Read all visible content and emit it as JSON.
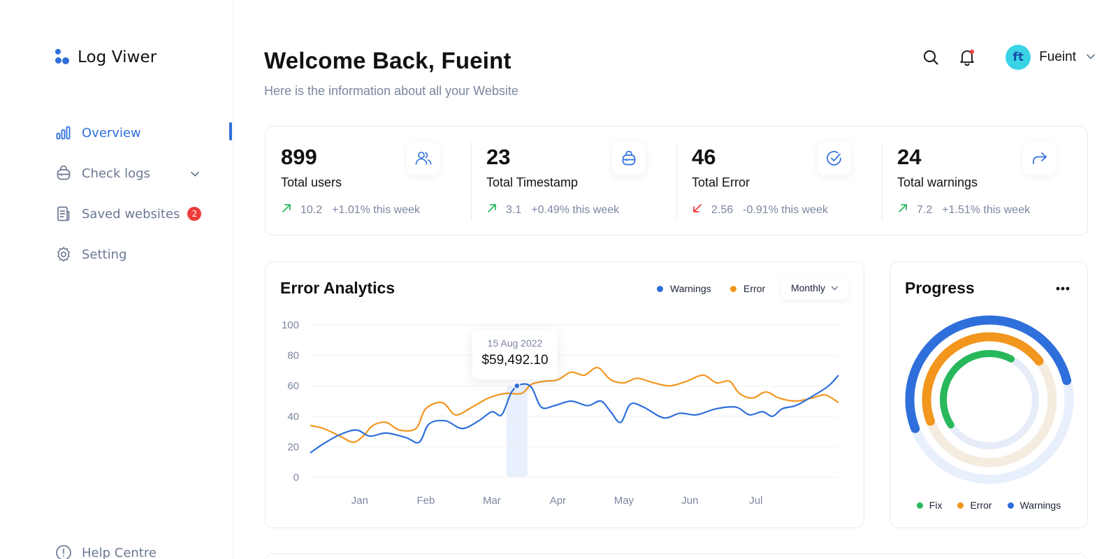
{
  "app": {
    "title": "Log Viwer"
  },
  "sidebar": {
    "items": [
      {
        "label": "Overview",
        "icon": "bar-chart-icon",
        "active": true
      },
      {
        "label": "Check logs",
        "icon": "bag-icon",
        "has_submenu": true
      },
      {
        "label": "Saved websites",
        "icon": "document-icon",
        "badge": "2"
      },
      {
        "label": "Setting",
        "icon": "gear-icon"
      }
    ],
    "help": {
      "label": "Help Centre",
      "icon": "info-icon"
    }
  },
  "header": {
    "title": "Welcome Back, Fueint",
    "subtitle": "Here is the information about all your Website",
    "user": {
      "name": "Fueint",
      "avatar_text": "ft"
    }
  },
  "stats": [
    {
      "value": "899",
      "label": "Total users",
      "trend_value": "10.2",
      "trend_text": "+1.01% this week",
      "direction": "up",
      "icon": "users-icon"
    },
    {
      "value": "23",
      "label": "Total Timestamp",
      "trend_value": "3.1",
      "trend_text": "+0.49% this week",
      "direction": "up",
      "icon": "bag-icon"
    },
    {
      "value": "46",
      "label": "Total Error",
      "trend_value": "2.56",
      "trend_text": "-0.91% this week",
      "direction": "down",
      "icon": "check-circle-icon"
    },
    {
      "value": "24",
      "label": "Total warnings",
      "trend_value": "7.2",
      "trend_text": "+1.51% this week",
      "direction": "up",
      "icon": "share-icon"
    }
  ],
  "analytics": {
    "title": "Error Analytics",
    "legend": [
      {
        "label": "Warnings",
        "color": "#2f6fdb"
      },
      {
        "label": "Error",
        "color": "#f2961e"
      }
    ],
    "period": "Monthly",
    "tooltip": {
      "date": "15 Aug 2022",
      "value": "$59,492.10"
    }
  },
  "chart_data": {
    "type": "line",
    "categories": [
      "Jan",
      "Feb",
      "Mar",
      "Apr",
      "May",
      "Jun",
      "Jul"
    ],
    "ylim": [
      0,
      100
    ],
    "yticks": [
      0,
      20,
      40,
      60,
      80,
      100
    ],
    "x_range": [
      0.25,
      7.5
    ],
    "grid": true,
    "series": [
      {
        "name": "Warnings",
        "color": "#2f6fdb",
        "points": [
          [
            0.25,
            16
          ],
          [
            0.45,
            22
          ],
          [
            0.7,
            28
          ],
          [
            0.95,
            31
          ],
          [
            1.15,
            27
          ],
          [
            1.4,
            29
          ],
          [
            1.7,
            26
          ],
          [
            1.9,
            23
          ],
          [
            2.05,
            35
          ],
          [
            2.3,
            37
          ],
          [
            2.55,
            32
          ],
          [
            2.8,
            37
          ],
          [
            3.0,
            43
          ],
          [
            3.15,
            41
          ],
          [
            3.3,
            56
          ],
          [
            3.45,
            61
          ],
          [
            3.6,
            59
          ],
          [
            3.75,
            46
          ],
          [
            3.95,
            47
          ],
          [
            4.2,
            50
          ],
          [
            4.45,
            47
          ],
          [
            4.65,
            50
          ],
          [
            4.8,
            43
          ],
          [
            4.95,
            36
          ],
          [
            5.1,
            48
          ],
          [
            5.3,
            46
          ],
          [
            5.6,
            39
          ],
          [
            5.85,
            42
          ],
          [
            6.1,
            41
          ],
          [
            6.4,
            45
          ],
          [
            6.7,
            46
          ],
          [
            6.9,
            41
          ],
          [
            7.1,
            43
          ],
          [
            7.25,
            40
          ],
          [
            7.4,
            45
          ],
          [
            7.6,
            47
          ],
          [
            7.85,
            53
          ],
          [
            8.1,
            60
          ],
          [
            8.25,
            67
          ]
        ]
      },
      {
        "name": "Error",
        "color": "#f2961e",
        "points": [
          [
            0.25,
            34
          ],
          [
            0.45,
            32
          ],
          [
            0.7,
            27
          ],
          [
            0.9,
            23
          ],
          [
            1.05,
            27
          ],
          [
            1.2,
            34
          ],
          [
            1.4,
            36
          ],
          [
            1.6,
            31
          ],
          [
            1.85,
            32
          ],
          [
            2.0,
            45
          ],
          [
            2.25,
            49
          ],
          [
            2.45,
            41
          ],
          [
            2.7,
            46
          ],
          [
            2.95,
            52
          ],
          [
            3.2,
            55
          ],
          [
            3.45,
            55
          ],
          [
            3.6,
            61
          ],
          [
            3.8,
            63
          ],
          [
            4.0,
            64
          ],
          [
            4.2,
            69
          ],
          [
            4.4,
            67
          ],
          [
            4.6,
            72
          ],
          [
            4.8,
            64
          ],
          [
            5.0,
            62
          ],
          [
            5.2,
            65
          ],
          [
            5.45,
            62
          ],
          [
            5.7,
            60
          ],
          [
            5.95,
            63
          ],
          [
            6.2,
            67
          ],
          [
            6.4,
            62
          ],
          [
            6.6,
            63
          ],
          [
            6.75,
            55
          ],
          [
            6.95,
            52
          ],
          [
            7.15,
            56
          ],
          [
            7.35,
            52
          ],
          [
            7.6,
            50
          ],
          [
            7.85,
            52
          ],
          [
            8.05,
            54
          ],
          [
            8.25,
            49
          ]
        ]
      }
    ]
  },
  "progress": {
    "title": "Progress",
    "legend": [
      {
        "label": "Fix",
        "color": "#27b85b"
      },
      {
        "label": "Error",
        "color": "#f2961e"
      },
      {
        "label": "Warnings",
        "color": "#2f6fdb"
      }
    ],
    "rings": [
      {
        "name": "Warnings",
        "value": 0.52,
        "color": "#2f6fdb"
      },
      {
        "name": "Error",
        "value": 0.45,
        "color": "#f2961e"
      },
      {
        "name": "Fix",
        "value": 0.42,
        "color": "#27b85b"
      }
    ]
  }
}
